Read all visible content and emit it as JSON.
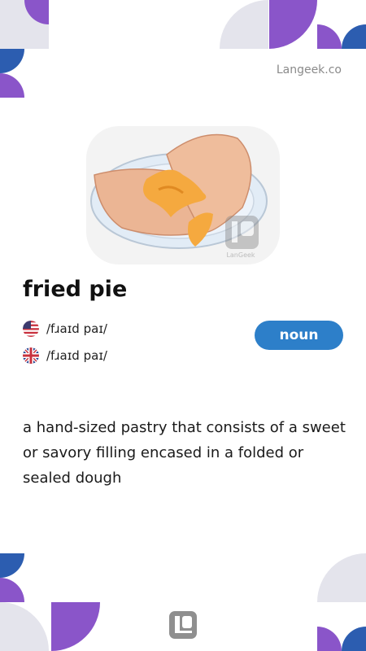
{
  "brand": {
    "site_label": "Langeek.co",
    "watermark_text": "LanGeek"
  },
  "entry": {
    "word": "fried pie",
    "part_of_speech": "noun",
    "pronunciations": [
      {
        "region": "US",
        "ipa": "/fɹaɪd paɪ/",
        "flag_icon": "us-flag-icon"
      },
      {
        "region": "UK",
        "ipa": "/fɹaɪd paɪ/",
        "flag_icon": "uk-flag-icon"
      }
    ],
    "definition": "a hand-sized pastry that consists of a sweet or savory filling encased in a folded or sealed dough"
  },
  "colors": {
    "accent_purple": "#8a55c9",
    "accent_blue": "#2c5db0",
    "decor_gray": "#e4e4ec",
    "badge_blue": "#2d7fc9"
  }
}
